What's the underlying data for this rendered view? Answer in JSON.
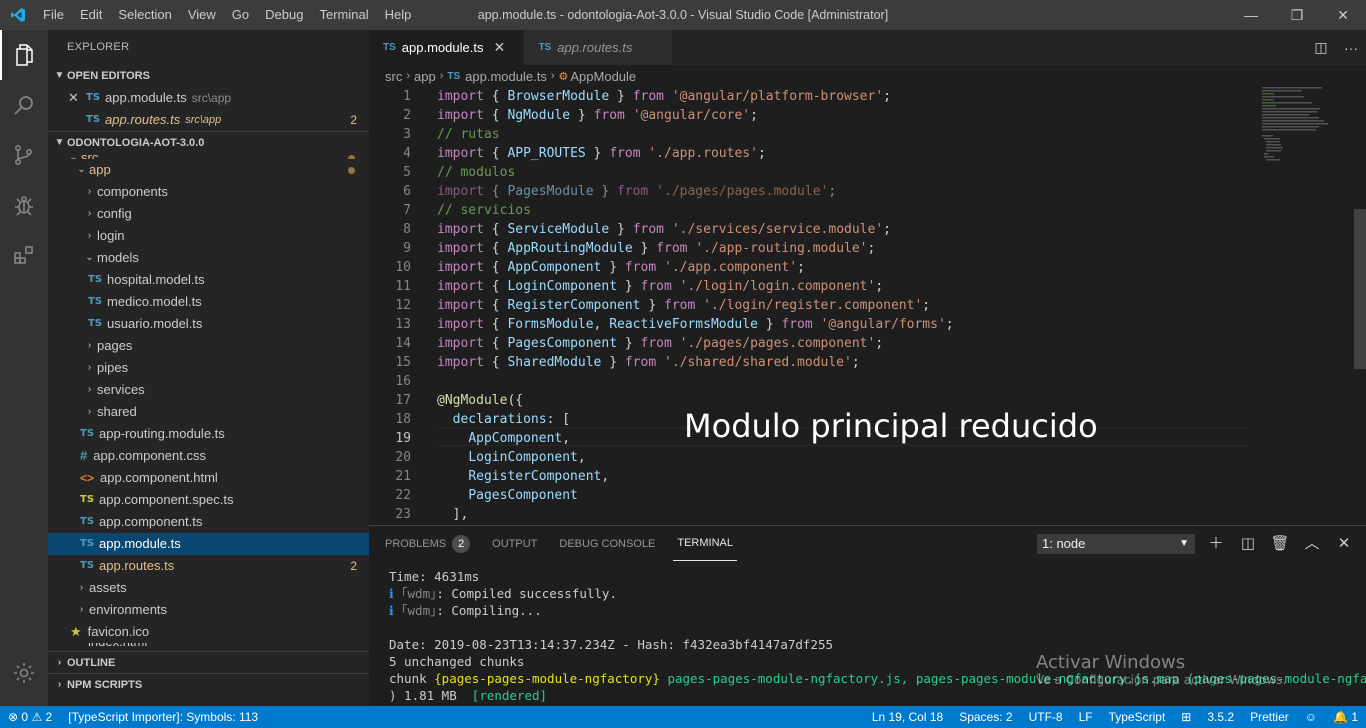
{
  "window": {
    "title": "app.module.ts - odontologia-Aot-3.0.0 - Visual Studio Code [Administrator]",
    "menu": [
      "File",
      "Edit",
      "Selection",
      "View",
      "Go",
      "Debug",
      "Terminal",
      "Help"
    ],
    "controls": {
      "minimize": "—",
      "maximize": "❐",
      "close": "✕"
    }
  },
  "activity_bar": [
    "files-icon",
    "search-icon",
    "source-control-icon",
    "debug-icon",
    "extensions-icon",
    "settings-gear-icon"
  ],
  "sidebar": {
    "title": "EXPLORER",
    "open_editors": {
      "label": "OPEN EDITORS",
      "items": [
        {
          "icon": "TS",
          "name": "app.module.ts",
          "path": "src\\app",
          "badge": ""
        },
        {
          "icon": "TS",
          "name": "app.routes.ts",
          "path": "src\\app",
          "badge": "2"
        }
      ]
    },
    "project": {
      "label": "ODONTOLOGIA-AOT-3.0.0",
      "tree": [
        {
          "name": "src"
        },
        {
          "name": "app"
        },
        {
          "name": "components"
        },
        {
          "name": "config"
        },
        {
          "name": "login"
        },
        {
          "name": "models"
        },
        {
          "name": "hospital.model.ts",
          "icon": "TS"
        },
        {
          "name": "medico.model.ts",
          "icon": "TS"
        },
        {
          "name": "usuario.model.ts",
          "icon": "TS"
        },
        {
          "name": "pages"
        },
        {
          "name": "pipes"
        },
        {
          "name": "services"
        },
        {
          "name": "shared"
        },
        {
          "name": "app-routing.module.ts",
          "icon": "TS"
        },
        {
          "name": "app.component.css",
          "icon": "#"
        },
        {
          "name": "app.component.html",
          "icon": "<>"
        },
        {
          "name": "app.component.spec.ts",
          "icon": "TS"
        },
        {
          "name": "app.component.ts",
          "icon": "TS"
        },
        {
          "name": "app.module.ts",
          "icon": "TS"
        },
        {
          "name": "app.routes.ts",
          "icon": "TS",
          "badge": "2"
        },
        {
          "name": "assets"
        },
        {
          "name": "environments"
        },
        {
          "name": "favicon.ico",
          "icon": "★"
        },
        {
          "name": "index.html"
        }
      ]
    },
    "outline_label": "OUTLINE",
    "npm_label": "NPM SCRIPTS"
  },
  "tabs": [
    {
      "icon": "TS",
      "label": "app.module.ts",
      "close": "✕"
    },
    {
      "icon": "TS",
      "label": "app.routes.ts"
    }
  ],
  "breadcrumb": {
    "parts": [
      "src",
      "app",
      "app.module.ts",
      "AppModule"
    ],
    "sep": "›"
  },
  "editor": {
    "line_numbers": [
      "1",
      "2",
      "3",
      "4",
      "5",
      "6",
      "7",
      "8",
      "9",
      "10",
      "11",
      "12",
      "13",
      "14",
      "15",
      "16",
      "17",
      "18",
      "19",
      "20",
      "21",
      "22",
      "23"
    ],
    "lines": [
      "import { BrowserModule } from '@angular/platform-browser';",
      "import { NgModule } from '@angular/core';",
      "// rutas",
      "import { APP_ROUTES } from './app.routes';",
      "// modulos",
      "import { PagesModule } from './pages/pages.module';",
      "// servicios",
      "import { ServiceModule } from './services/service.module';",
      "import { AppRoutingModule } from './app-routing.module';",
      "import { AppComponent } from './app.component';",
      "import { LoginComponent } from './login/login.component';",
      "import { RegisterComponent } from './login/register.component';",
      "import { FormsModule, ReactiveFormsModule } from '@angular/forms';",
      "import { PagesComponent } from './pages/pages.component';",
      "import { SharedModule } from './shared/shared.module';",
      "",
      "@NgModule({",
      "  declarations: [",
      "    AppComponent,",
      "    LoginComponent,",
      "    RegisterComponent,",
      "    PagesComponent",
      "  ],"
    ],
    "overlay_text": "Modulo principal reducido"
  },
  "panel": {
    "tabs": [
      {
        "label": "PROBLEMS",
        "badge": "2"
      },
      {
        "label": "OUTPUT"
      },
      {
        "label": "DEBUG CONSOLE"
      },
      {
        "label": "TERMINAL"
      }
    ],
    "terminal_select": "1: node",
    "terminal_lines": [
      "Time: 4631ms",
      "ℹ ｢wdm｣: Compiled successfully.",
      "ℹ ｢wdm｣: Compiling...",
      "",
      "Date: 2019-08-23T13:14:37.234Z - Hash: f432ea3bf4147a7df255",
      "5 unchanged chunks",
      "chunk {pages-pages-module-ngfactory} pages-pages-module-ngfactory.js, pages-pages-module-ngfactory.js.map (pages-pages-module-ngfactor",
      ") 1.81 MB  [rendered]"
    ],
    "watermark": {
      "line1": "Activar Windows",
      "line2": "Ve a Configuración para activar Windows."
    }
  },
  "statusbar": {
    "errors": "0",
    "warnings": "2",
    "importer": "[TypeScript Importer]: Symbols: 113",
    "position": "Ln 19, Col 18",
    "spaces": "Spaces: 2",
    "encoding": "UTF-8",
    "eol": "LF",
    "language": "TypeScript",
    "ts_version": "3.5.2",
    "formatter": "Prettier",
    "notifications": "1"
  },
  "colors": {
    "accent": "#007acc",
    "selection": "#094771",
    "titlebar": "#3c3c3c"
  }
}
